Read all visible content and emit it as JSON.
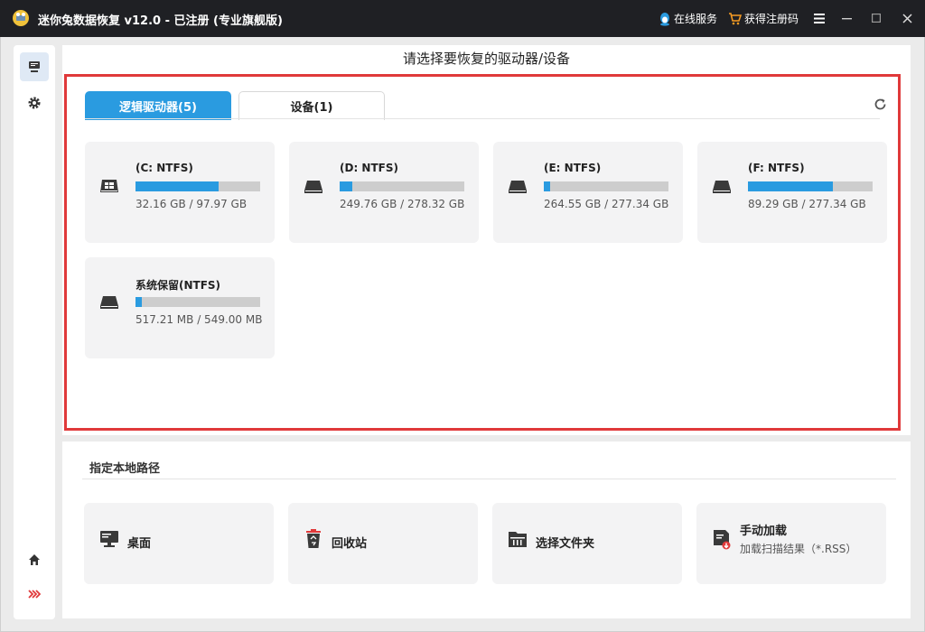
{
  "titlebar": {
    "title": "迷你兔数据恢复 v12.0 - 已注册 (专业旗舰版)",
    "online_service": "在线服务",
    "get_code": "获得注册码"
  },
  "main": {
    "heading": "请选择要恢复的驱动器/设备",
    "tabs": [
      {
        "label": "逻辑驱动器(5)",
        "active": true
      },
      {
        "label": "设备(1)",
        "active": false
      }
    ],
    "drives": [
      {
        "name": "(C: NTFS)",
        "size": "32.16 GB / 97.97 GB",
        "used_fraction": 0.67,
        "icon": "windows-drive-icon"
      },
      {
        "name": "(D: NTFS)",
        "size": "249.76 GB / 278.32 GB",
        "used_fraction": 0.1,
        "icon": "drive-icon"
      },
      {
        "name": "(E: NTFS)",
        "size": "264.55 GB / 277.34 GB",
        "used_fraction": 0.05,
        "icon": "drive-icon"
      },
      {
        "name": "(F: NTFS)",
        "size": "89.29 GB / 277.34 GB",
        "used_fraction": 0.68,
        "icon": "drive-icon"
      },
      {
        "name": "系统保留(NTFS)",
        "size": "517.21 MB / 549.00 MB",
        "used_fraction": 0.05,
        "icon": "drive-icon"
      }
    ]
  },
  "bottom": {
    "title": "指定本地路径",
    "locations": [
      {
        "label": "桌面",
        "icon": "desktop-icon"
      },
      {
        "label": "回收站",
        "icon": "recycle-bin-icon"
      },
      {
        "label": "选择文件夹",
        "icon": "folder-icon"
      },
      {
        "label": "手动加载",
        "sub": "加载扫描结果（*.RSS）",
        "icon": "load-file-icon"
      }
    ]
  },
  "colors": {
    "accent": "#2a9be0",
    "highlight_border": "#e0393a",
    "titlebar": "#1f2024"
  }
}
